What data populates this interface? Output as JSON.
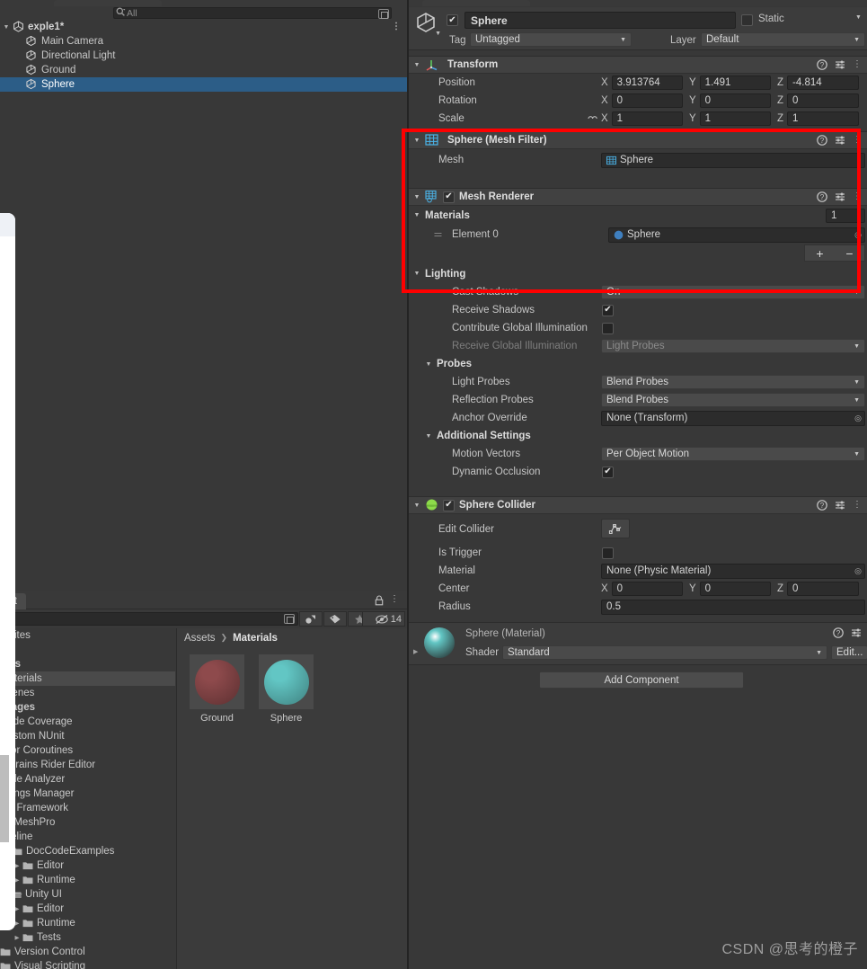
{
  "app": "Unity Editor",
  "hierarchy": {
    "search_placeholder": "All",
    "scene_name": "exple1*",
    "items": [
      {
        "label": "Main Camera",
        "icon": "cube-icon",
        "selected": false
      },
      {
        "label": "Directional Light",
        "icon": "cube-icon",
        "selected": false
      },
      {
        "label": "Ground",
        "icon": "cube-icon",
        "selected": false
      },
      {
        "label": "Sphere",
        "icon": "cube-icon",
        "selected": true
      }
    ]
  },
  "project": {
    "tab_label": "ct",
    "asset_count": "14",
    "breadcrumb": {
      "root": "Assets",
      "current": "Materials"
    },
    "tree": [
      {
        "label": "vorites",
        "bold": false,
        "kind": "favorites",
        "selected": false,
        "indent": 0
      },
      {
        "label": "",
        "bold": false,
        "kind": "blank",
        "selected": false,
        "indent": 0
      },
      {
        "label": "sets",
        "bold": true,
        "kind": "plain",
        "selected": false,
        "indent": 0
      },
      {
        "label": "Materials",
        "bold": false,
        "kind": "plain",
        "selected": true,
        "indent": 0
      },
      {
        "label": "Scenes",
        "bold": false,
        "kind": "plain",
        "selected": false,
        "indent": 0
      },
      {
        "label": "ckages",
        "bold": true,
        "kind": "plain",
        "selected": false,
        "indent": 0
      },
      {
        "label": "Code Coverage",
        "bold": false,
        "kind": "plain",
        "selected": false,
        "indent": 0
      },
      {
        "label": "Custom NUnit",
        "bold": false,
        "kind": "plain",
        "selected": false,
        "indent": 0
      },
      {
        "label": "ditor Coroutines",
        "bold": false,
        "kind": "plain",
        "selected": false,
        "indent": 0
      },
      {
        "label": "etBrains Rider Editor",
        "bold": false,
        "kind": "plain",
        "selected": false,
        "indent": 0
      },
      {
        "label": "rofile Analyzer",
        "bold": false,
        "kind": "plain",
        "selected": false,
        "indent": 0
      },
      {
        "label": "ettings Manager",
        "bold": false,
        "kind": "plain",
        "selected": false,
        "indent": 0
      },
      {
        "label": "est Framework",
        "bold": false,
        "kind": "plain",
        "selected": false,
        "indent": 0
      },
      {
        "label": "extMeshPro",
        "bold": false,
        "kind": "plain",
        "selected": false,
        "indent": 0
      },
      {
        "label": "imeline",
        "bold": false,
        "kind": "plain",
        "selected": false,
        "indent": 0
      },
      {
        "label": "DocCodeExamples",
        "bold": false,
        "kind": "folder",
        "selected": false,
        "indent": 1
      },
      {
        "label": "Editor",
        "bold": false,
        "kind": "folder-arrow",
        "selected": false,
        "indent": 1
      },
      {
        "label": "Runtime",
        "bold": false,
        "kind": "folder-arrow",
        "selected": false,
        "indent": 1
      },
      {
        "label": "Unity UI",
        "bold": false,
        "kind": "folder-open",
        "selected": false,
        "indent": 0
      },
      {
        "label": "Editor",
        "bold": false,
        "kind": "folder-arrow",
        "selected": false,
        "indent": 1
      },
      {
        "label": "Runtime",
        "bold": false,
        "kind": "folder-arrow",
        "selected": false,
        "indent": 1
      },
      {
        "label": "Tests",
        "bold": false,
        "kind": "folder-arrow",
        "selected": false,
        "indent": 1
      },
      {
        "label": "Version Control",
        "bold": false,
        "kind": "folder",
        "selected": false,
        "indent": 0
      },
      {
        "label": "Visual Scripting",
        "bold": false,
        "kind": "folder",
        "selected": false,
        "indent": 0
      }
    ],
    "assets": [
      {
        "name": "Ground",
        "color": "#8e4a4c"
      },
      {
        "name": "Sphere",
        "color": "#62c6c4"
      }
    ]
  },
  "inspector": {
    "gameobject": {
      "enabled": true,
      "name": "Sphere",
      "static_label": "Static",
      "tag_label": "Tag",
      "tag_value": "Untagged",
      "layer_label": "Layer",
      "layer_value": "Default"
    },
    "transform": {
      "title": "Transform",
      "position": {
        "label": "Position",
        "x": "3.913764",
        "y": "1.491",
        "z": "-4.814"
      },
      "rotation": {
        "label": "Rotation",
        "x": "0",
        "y": "0",
        "z": "0"
      },
      "scale": {
        "label": "Scale",
        "x": "1",
        "y": "1",
        "z": "1"
      },
      "axis_x": "X",
      "axis_y": "Y",
      "axis_z": "Z"
    },
    "mesh_filter": {
      "title": "Sphere (Mesh Filter)",
      "mesh_label": "Mesh",
      "mesh_value": "Sphere"
    },
    "mesh_renderer": {
      "title": "Mesh Renderer",
      "enabled": true,
      "materials_label": "Materials",
      "materials_size": "1",
      "element_label": "Element 0",
      "element_value": "Sphere",
      "add_label": "+",
      "remove_label": "−",
      "lighting_label": "Lighting",
      "cast_shadows_label": "Cast Shadows",
      "cast_shadows_value": "On",
      "receive_shadows_label": "Receive Shadows",
      "receive_shadows_value": true,
      "contribute_gi_label": "Contribute Global Illumination",
      "contribute_gi_value": false,
      "receive_gi_label": "Receive Global Illumination",
      "receive_gi_value": "Light Probes",
      "probes_label": "Probes",
      "light_probes_label": "Light Probes",
      "light_probes_value": "Blend Probes",
      "reflection_probes_label": "Reflection Probes",
      "reflection_probes_value": "Blend Probes",
      "anchor_override_label": "Anchor Override",
      "anchor_override_value": "None (Transform)",
      "additional_settings_label": "Additional Settings",
      "motion_vectors_label": "Motion Vectors",
      "motion_vectors_value": "Per Object Motion",
      "dynamic_occlusion_label": "Dynamic Occlusion",
      "dynamic_occlusion_value": true
    },
    "sphere_collider": {
      "title": "Sphere Collider",
      "enabled": true,
      "edit_collider_label": "Edit Collider",
      "is_trigger_label": "Is Trigger",
      "is_trigger_value": false,
      "material_label": "Material",
      "material_value": "None (Physic Material)",
      "center_label": "Center",
      "center_x": "0",
      "center_y": "0",
      "center_z": "0",
      "radius_label": "Radius",
      "radius_value": "0.5"
    },
    "material": {
      "title": "Sphere (Material)",
      "shader_label": "Shader",
      "shader_value": "Standard",
      "edit_label": "Edit...",
      "preview_color": "#62c6c4"
    },
    "add_component_label": "Add Component"
  },
  "annotation": {
    "highlight_color": "#fe0000"
  },
  "watermark": "CSDN @思考的橙子"
}
